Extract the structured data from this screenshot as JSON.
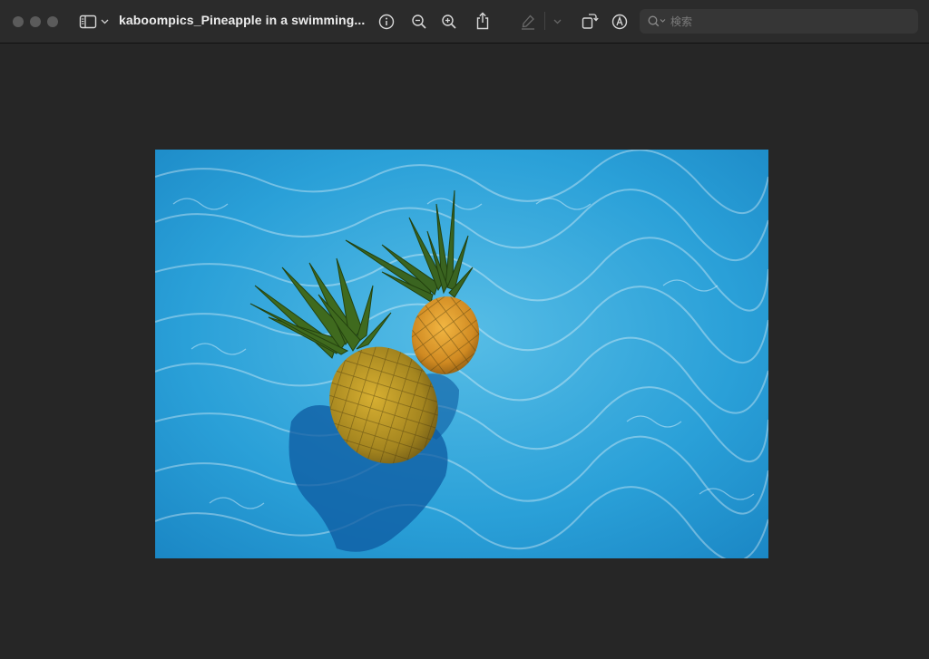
{
  "window": {
    "title": "kaboompics_Pineapple in a swimming...",
    "traffic_lights": [
      "close",
      "minimize",
      "zoom"
    ]
  },
  "toolbar": {
    "icons": {
      "sidebar": "sidebar-icon",
      "sidebar_menu": "chevron-down-icon",
      "info": "info-icon",
      "zoom_out": "zoom-out-icon",
      "zoom_in": "zoom-in-icon",
      "share": "share-icon",
      "highlight": "highlight-pen-icon",
      "highlight_menu": "chevron-down-icon",
      "rotate": "rotate-icon",
      "markup": "markup-icon",
      "search": "search-icon"
    }
  },
  "search": {
    "placeholder": "検索",
    "value": ""
  },
  "document": {
    "image_subject": "two pineapples floating in a swimming pool"
  },
  "colors": {
    "toolbar_bg": "#2b2b2b",
    "canvas_bg": "#262626",
    "water": "#2a9fd6",
    "pineapple": "#d49a2a"
  }
}
